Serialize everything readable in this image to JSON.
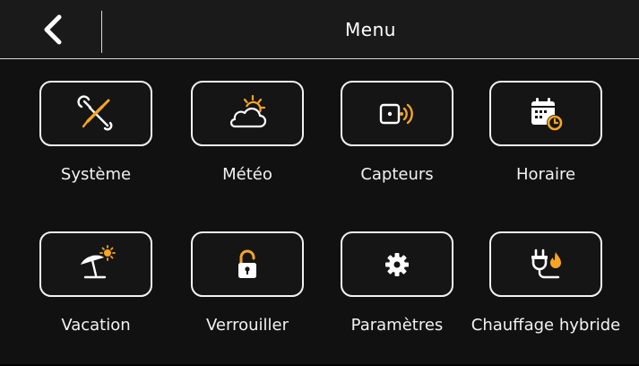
{
  "header": {
    "title": "Menu"
  },
  "colors": {
    "background": "#111112",
    "header_background": "#1a1a1b",
    "text": "#f2f2f2",
    "accent": "#f5a623"
  },
  "menu": {
    "items": [
      {
        "label": "Système",
        "icon": "tools-icon"
      },
      {
        "label": "Météo",
        "icon": "weather-icon"
      },
      {
        "label": "Capteurs",
        "icon": "sensor-icon"
      },
      {
        "label": "Horaire",
        "icon": "schedule-icon"
      },
      {
        "label": "Vacation",
        "icon": "vacation-icon"
      },
      {
        "label": "Verrouiller",
        "icon": "lock-icon"
      },
      {
        "label": "Paramètres",
        "icon": "gear-icon"
      },
      {
        "label": "Chauffage hybride",
        "icon": "hybrid-heating-icon"
      }
    ]
  }
}
